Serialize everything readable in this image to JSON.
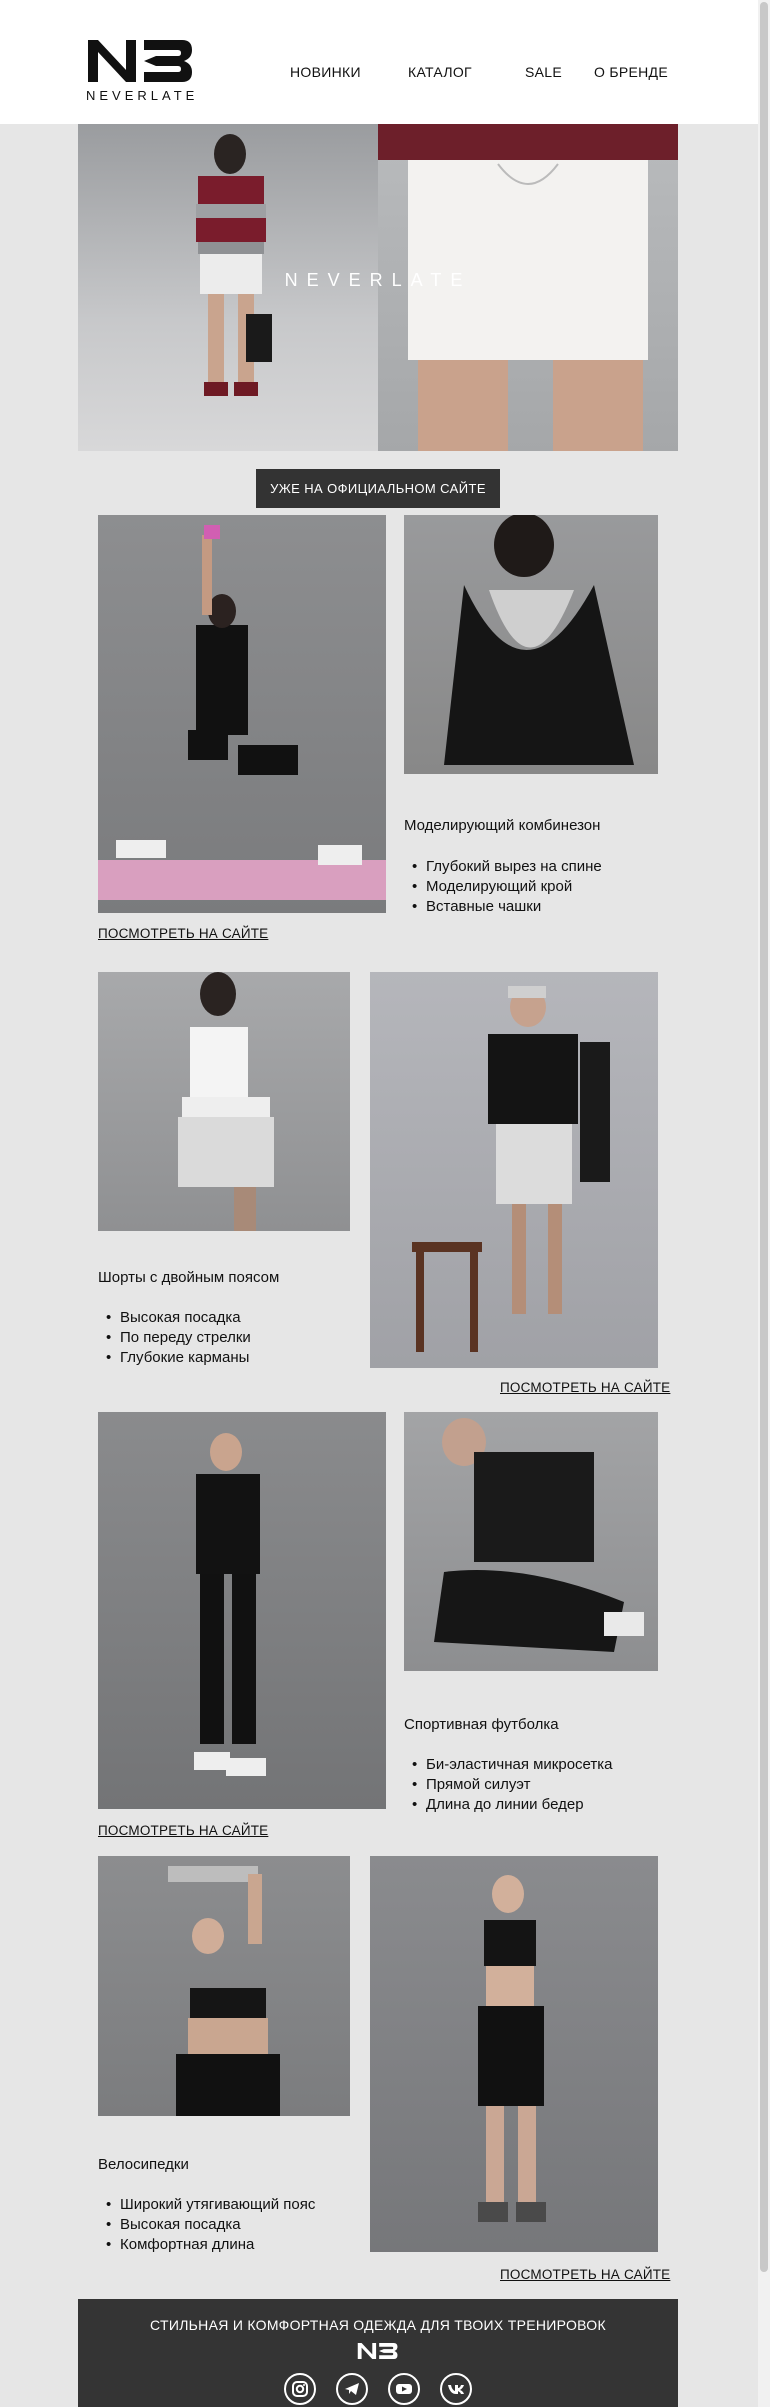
{
  "brand": {
    "logo_text": "NEVERLATE",
    "hero_overlay": "NEVERLATE"
  },
  "nav": [
    {
      "label": "НОВИНКИ"
    },
    {
      "label": "КАТАЛОГ"
    },
    {
      "label": "SALE"
    },
    {
      "label": "О БРЕНДЕ"
    }
  ],
  "cta_label": "УЖЕ НА ОФИЦИАЛЬНОМ САЙТЕ",
  "products": [
    {
      "title": "Моделирующий комбинезон",
      "bullets": [
        "Глубокий вырез на спине",
        "Моделирующий крой",
        "Вставные чашки"
      ],
      "link": "ПОСМОТРЕТЬ НА САЙТЕ"
    },
    {
      "title": "Шорты с двойным поясом",
      "bullets": [
        "Высокая посадка",
        "По переду стрелки",
        "Глубокие карманы"
      ],
      "link": "ПОСМОТРЕТЬ НА САЙТЕ"
    },
    {
      "title": "Спортивная футболка",
      "bullets": [
        "Би-эластичная микросетка",
        "Прямой силуэт",
        "Длина до линии бедер"
      ],
      "link": "ПОСМОТРЕТЬ НА САЙТЕ"
    },
    {
      "title": "Велосипедки",
      "bullets": [
        "Широкий утягивающий пояс",
        "Высокая посадка",
        "Комфортная длина"
      ],
      "link": "ПОСМОТРЕТЬ НА САЙТЕ"
    }
  ],
  "footer": {
    "tagline": "СТИЛЬНАЯ И КОМФОРТНАЯ ОДЕЖДА ДЛЯ ТВОИХ ТРЕНИРОВОК"
  },
  "social_icons": [
    "instagram-icon",
    "telegram-icon",
    "youtube-icon",
    "vk-icon"
  ],
  "colors": {
    "page_bg": "#e6e6e6",
    "cta_bg": "#333333",
    "footer_bg": "#343434"
  }
}
